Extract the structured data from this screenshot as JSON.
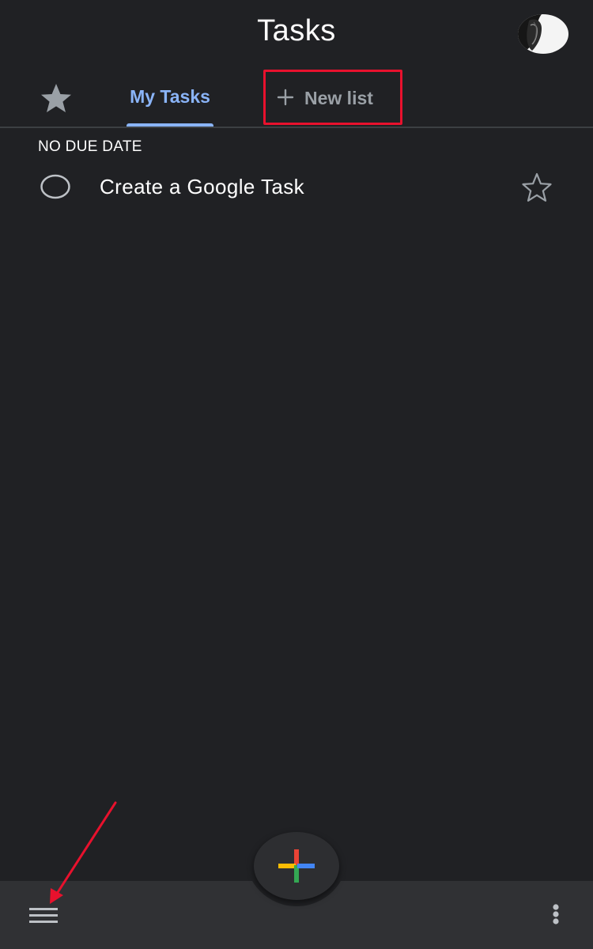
{
  "header": {
    "title": "Tasks"
  },
  "tabs": {
    "starred_icon": "star-filled-icon",
    "my_tasks_label": "My Tasks",
    "new_list_label": "New list",
    "new_list_icon": "plus-icon"
  },
  "section": {
    "header": "NO DUE DATE"
  },
  "tasks": [
    {
      "title": "Create a Google Task",
      "completed": false,
      "starred": false
    }
  ],
  "bottom_bar": {
    "menu_icon": "hamburger-menu-icon",
    "add_icon": "google-colored-plus-icon",
    "more_icon": "more-vertical-icon"
  },
  "annotations": {
    "highlight_color": "#e8112d",
    "arrow_color": "#e8112d"
  },
  "colors": {
    "background": "#202124",
    "bottom_bar": "#303134",
    "accent_blue": "#8ab4f8",
    "text_primary": "#ffffff",
    "text_secondary": "#9aa0a6",
    "plus_red": "#ea4335",
    "plus_yellow": "#fbbc04",
    "plus_green": "#34a853",
    "plus_blue": "#4285f4"
  }
}
